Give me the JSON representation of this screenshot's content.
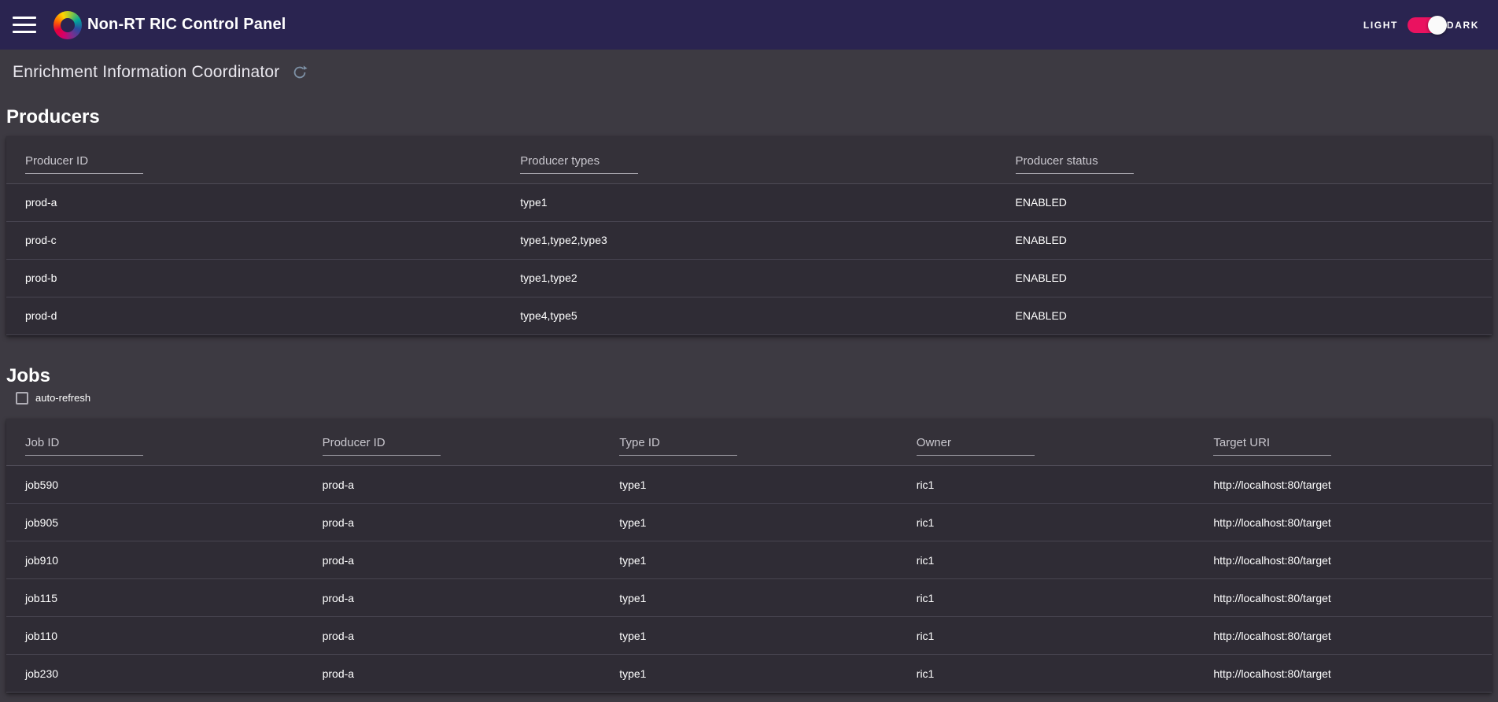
{
  "header": {
    "title": "Non-RT RIC Control Panel",
    "theme_toggle": {
      "light_label": "LIGHT",
      "dark_label": "DARK",
      "state": "dark",
      "accent_color": "#ea1260"
    }
  },
  "toolbar": {
    "title": "Enrichment Information Coordinator"
  },
  "producers": {
    "heading": "Producers",
    "filters": [
      {
        "placeholder": "Producer ID"
      },
      {
        "placeholder": "Producer types"
      },
      {
        "placeholder": "Producer status"
      }
    ],
    "rows": [
      {
        "id": "prod-a",
        "types": "type1",
        "status": "ENABLED"
      },
      {
        "id": "prod-c",
        "types": "type1,type2,type3",
        "status": "ENABLED"
      },
      {
        "id": "prod-b",
        "types": "type1,type2",
        "status": "ENABLED"
      },
      {
        "id": "prod-d",
        "types": "type4,type5",
        "status": "ENABLED"
      }
    ]
  },
  "jobs": {
    "heading": "Jobs",
    "auto_refresh_label": "auto-refresh",
    "filters": [
      {
        "placeholder": "Job ID"
      },
      {
        "placeholder": "Producer ID"
      },
      {
        "placeholder": "Type ID"
      },
      {
        "placeholder": "Owner"
      },
      {
        "placeholder": "Target URI"
      }
    ],
    "rows": [
      {
        "job_id": "job590",
        "producer_id": "prod-a",
        "type_id": "type1",
        "owner": "ric1",
        "target_uri": "http://localhost:80/target"
      },
      {
        "job_id": "job905",
        "producer_id": "prod-a",
        "type_id": "type1",
        "owner": "ric1",
        "target_uri": "http://localhost:80/target"
      },
      {
        "job_id": "job910",
        "producer_id": "prod-a",
        "type_id": "type1",
        "owner": "ric1",
        "target_uri": "http://localhost:80/target"
      },
      {
        "job_id": "job115",
        "producer_id": "prod-a",
        "type_id": "type1",
        "owner": "ric1",
        "target_uri": "http://localhost:80/target"
      },
      {
        "job_id": "job110",
        "producer_id": "prod-a",
        "type_id": "type1",
        "owner": "ric1",
        "target_uri": "http://localhost:80/target"
      },
      {
        "job_id": "job230",
        "producer_id": "prod-a",
        "type_id": "type1",
        "owner": "ric1",
        "target_uri": "http://localhost:80/target"
      }
    ]
  },
  "colors": {
    "topbar_bg": "#2a2450",
    "page_bg": "#3d3a42",
    "card_bg": "#2f2c35",
    "accent_pink": "#ea1260",
    "refresh_icon": "#7d90a5"
  }
}
